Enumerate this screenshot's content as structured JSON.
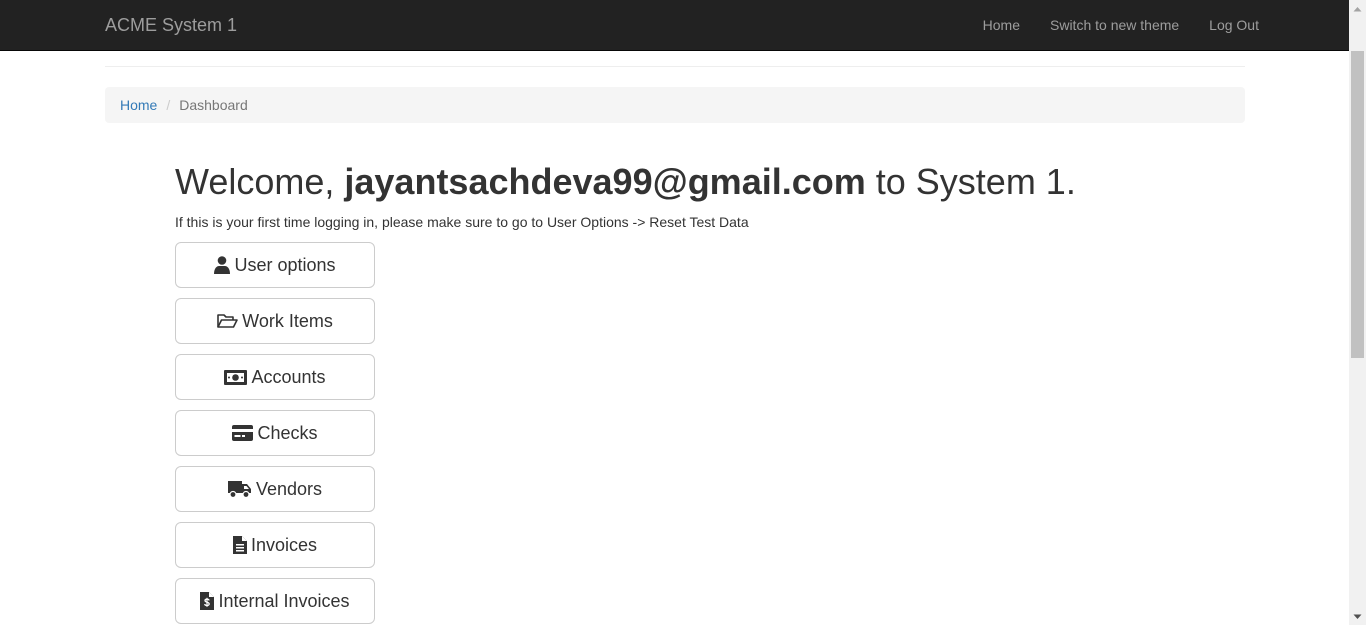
{
  "navbar": {
    "brand": "ACME System 1",
    "links": [
      "Home",
      "Switch to new theme",
      "Log Out"
    ]
  },
  "breadcrumb": {
    "home": "Home",
    "separator": "/",
    "current": "Dashboard"
  },
  "welcome": {
    "prefix": "Welcome, ",
    "user": "jayantsachdeva99@gmail.com",
    "suffix": " to System 1."
  },
  "notice": "If this is your first time logging in, please make sure to go to User Options -> Reset Test Data",
  "menu_buttons": [
    {
      "label": "User options",
      "icon": "user-icon"
    },
    {
      "label": "Work Items",
      "icon": "folder-open-icon"
    },
    {
      "label": "Accounts",
      "icon": "money-icon"
    },
    {
      "label": "Checks",
      "icon": "credit-card-icon"
    },
    {
      "label": "Vendors",
      "icon": "truck-icon"
    },
    {
      "label": "Invoices",
      "icon": "file-text-icon"
    },
    {
      "label": "Internal Invoices",
      "icon": "file-invoice-dollar-icon"
    }
  ],
  "colors": {
    "navbar_bg": "#222222",
    "navbar_text": "#9d9d9d",
    "link": "#337ab7",
    "breadcrumb_bg": "#f5f5f5"
  }
}
